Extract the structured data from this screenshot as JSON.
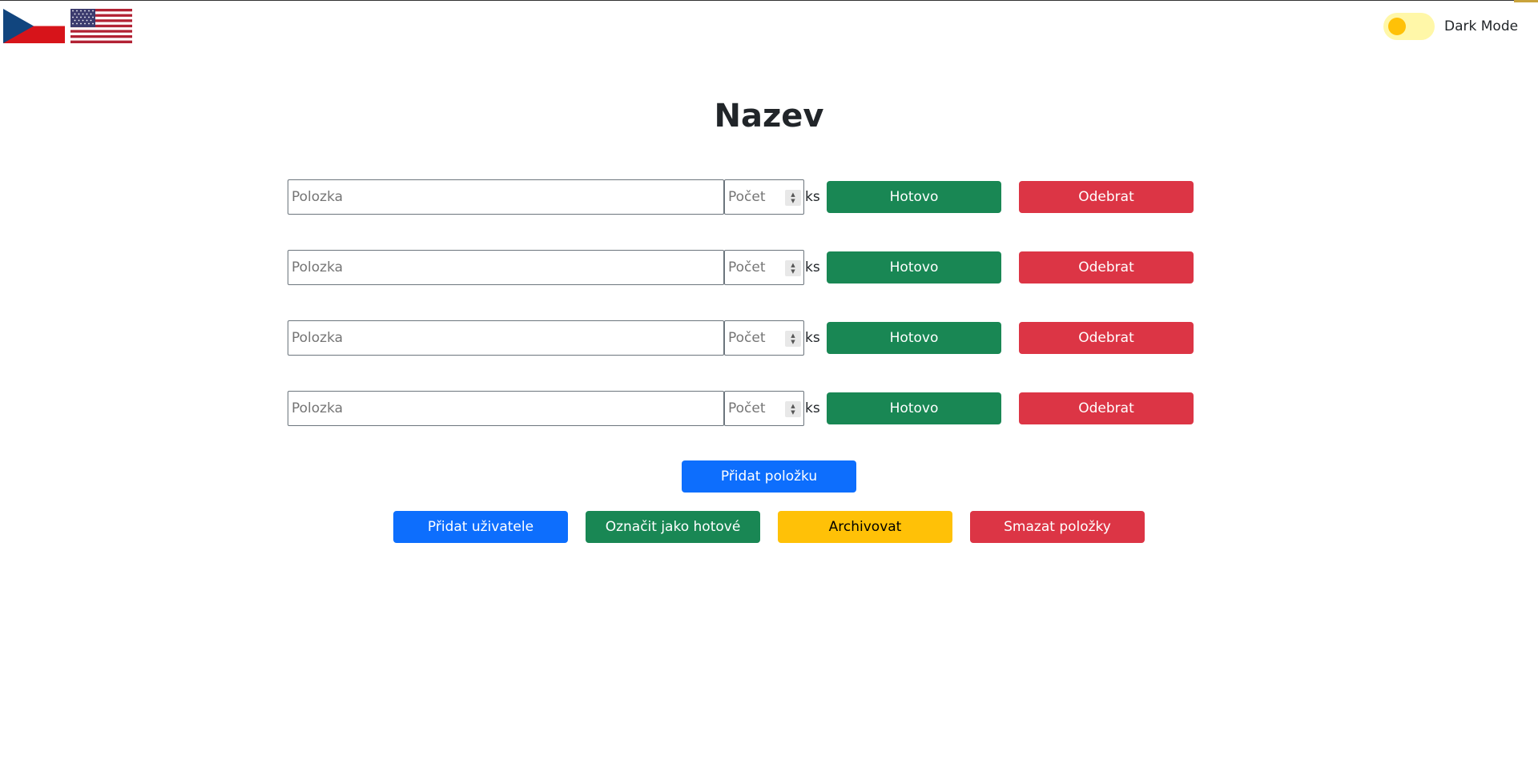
{
  "header": {
    "flags": [
      {
        "name": "czech-flag-icon",
        "label": "Czech"
      },
      {
        "name": "us-flag-icon",
        "label": "English"
      }
    ],
    "dark_mode_label": "Dark Mode"
  },
  "title": "Nazev",
  "items": [
    {
      "placeholder": "Polozka",
      "qty_placeholder": "Počet",
      "unit": "ks",
      "done_label": "Hotovo",
      "remove_label": "Odebrat"
    },
    {
      "placeholder": "Polozka",
      "qty_placeholder": "Počet",
      "unit": "ks",
      "done_label": "Hotovo",
      "remove_label": "Odebrat"
    },
    {
      "placeholder": "Polozka",
      "qty_placeholder": "Počet",
      "unit": "ks",
      "done_label": "Hotovo",
      "remove_label": "Odebrat"
    },
    {
      "placeholder": "Polozka",
      "qty_placeholder": "Počet",
      "unit": "ks",
      "done_label": "Hotovo",
      "remove_label": "Odebrat"
    }
  ],
  "actions": {
    "add_item": "Přidat položku",
    "add_user": "Přidat uživatele",
    "mark_done": "Označit jako hotové",
    "archive": "Archivovat",
    "delete_items": "Smazat položky"
  },
  "colors": {
    "primary": "#0d6efd",
    "success": "#198754",
    "danger": "#dc3545",
    "warning": "#ffc107"
  }
}
